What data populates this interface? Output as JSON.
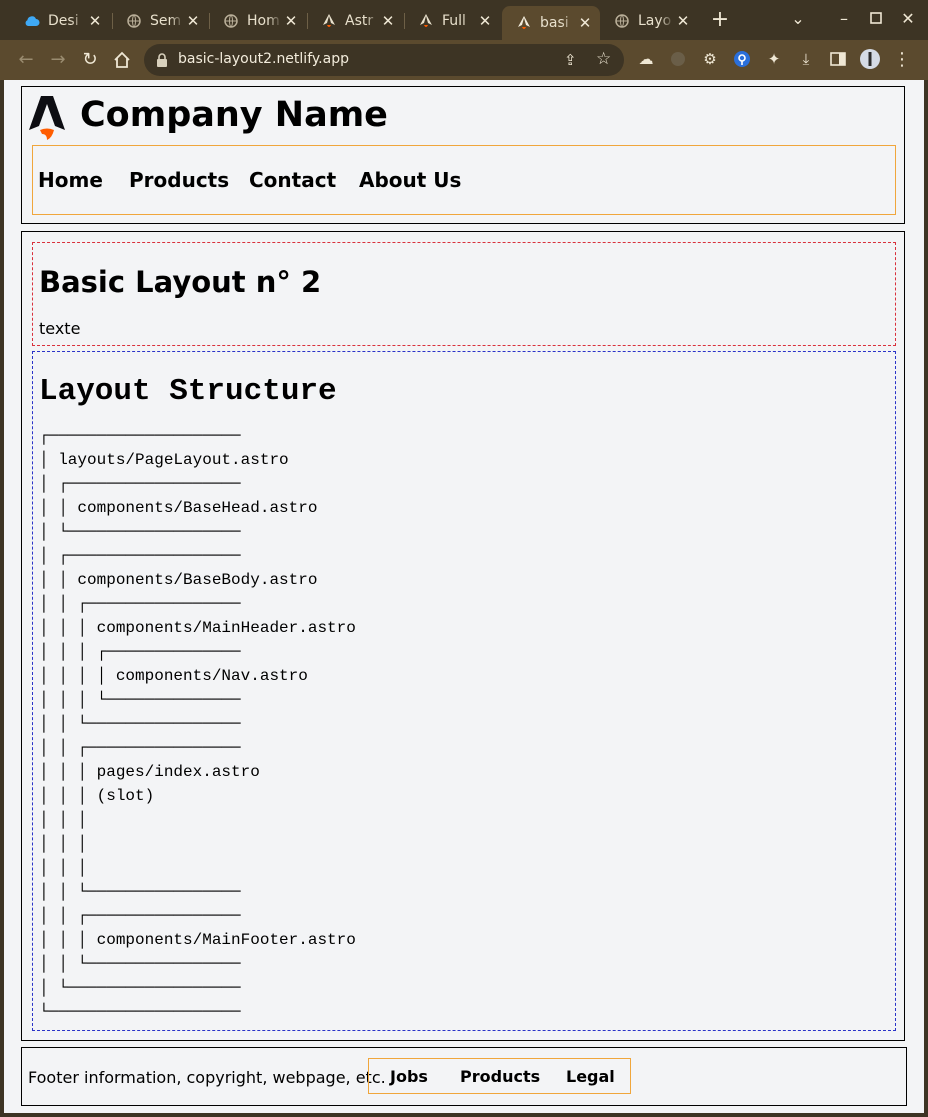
{
  "browser": {
    "tabs": [
      {
        "label": "Desi",
        "icon": "cloud-icon"
      },
      {
        "label": "Sem",
        "icon": "globe-icon"
      },
      {
        "label": "Hom",
        "icon": "globe-icon"
      },
      {
        "label": "Astr",
        "icon": "astro-icon"
      },
      {
        "label": "Full",
        "icon": "astro-icon"
      },
      {
        "label": "basi",
        "icon": "astro-icon",
        "active": true
      },
      {
        "label": "Layo",
        "icon": "globe-icon"
      }
    ],
    "url": "basic-layout2.netlify.app"
  },
  "header": {
    "company_name": "Company Name",
    "nav": [
      "Home",
      "Products",
      "Contact",
      "About Us"
    ]
  },
  "intro": {
    "title": "Basic Layout n° 2",
    "text": "texte"
  },
  "structure": {
    "title": "Layout Structure",
    "tree": "┌────────────────────\n│ layouts/PageLayout.astro\n│ ┌──────────────────\n│ │ components/BaseHead.astro\n│ └──────────────────\n│ ┌──────────────────\n│ │ components/BaseBody.astro\n│ │ ┌────────────────\n│ │ │ components/MainHeader.astro\n│ │ │ ┌──────────────\n│ │ │ │ components/Nav.astro\n│ │ │ └──────────────\n│ │ └────────────────\n│ │ ┌────────────────\n│ │ │ pages/index.astro\n│ │ │ (slot)\n│ │ │\n│ │ │\n│ │ │\n│ │ └────────────────\n│ │ ┌────────────────\n│ │ │ components/MainFooter.astro\n│ │ └────────────────\n│ └──────────────────\n└────────────────────"
  },
  "footer": {
    "text": "Footer information, copyright, webpage, etc.",
    "nav": [
      "Jobs",
      "Products",
      "Legal"
    ]
  },
  "colors": {
    "nav_border": "#f0a63c",
    "intro_border": "#d9303c",
    "structure_border": "#2a33c8",
    "chrome_bg": "#3d3424",
    "toolbar_bg": "#5b4a2e"
  }
}
